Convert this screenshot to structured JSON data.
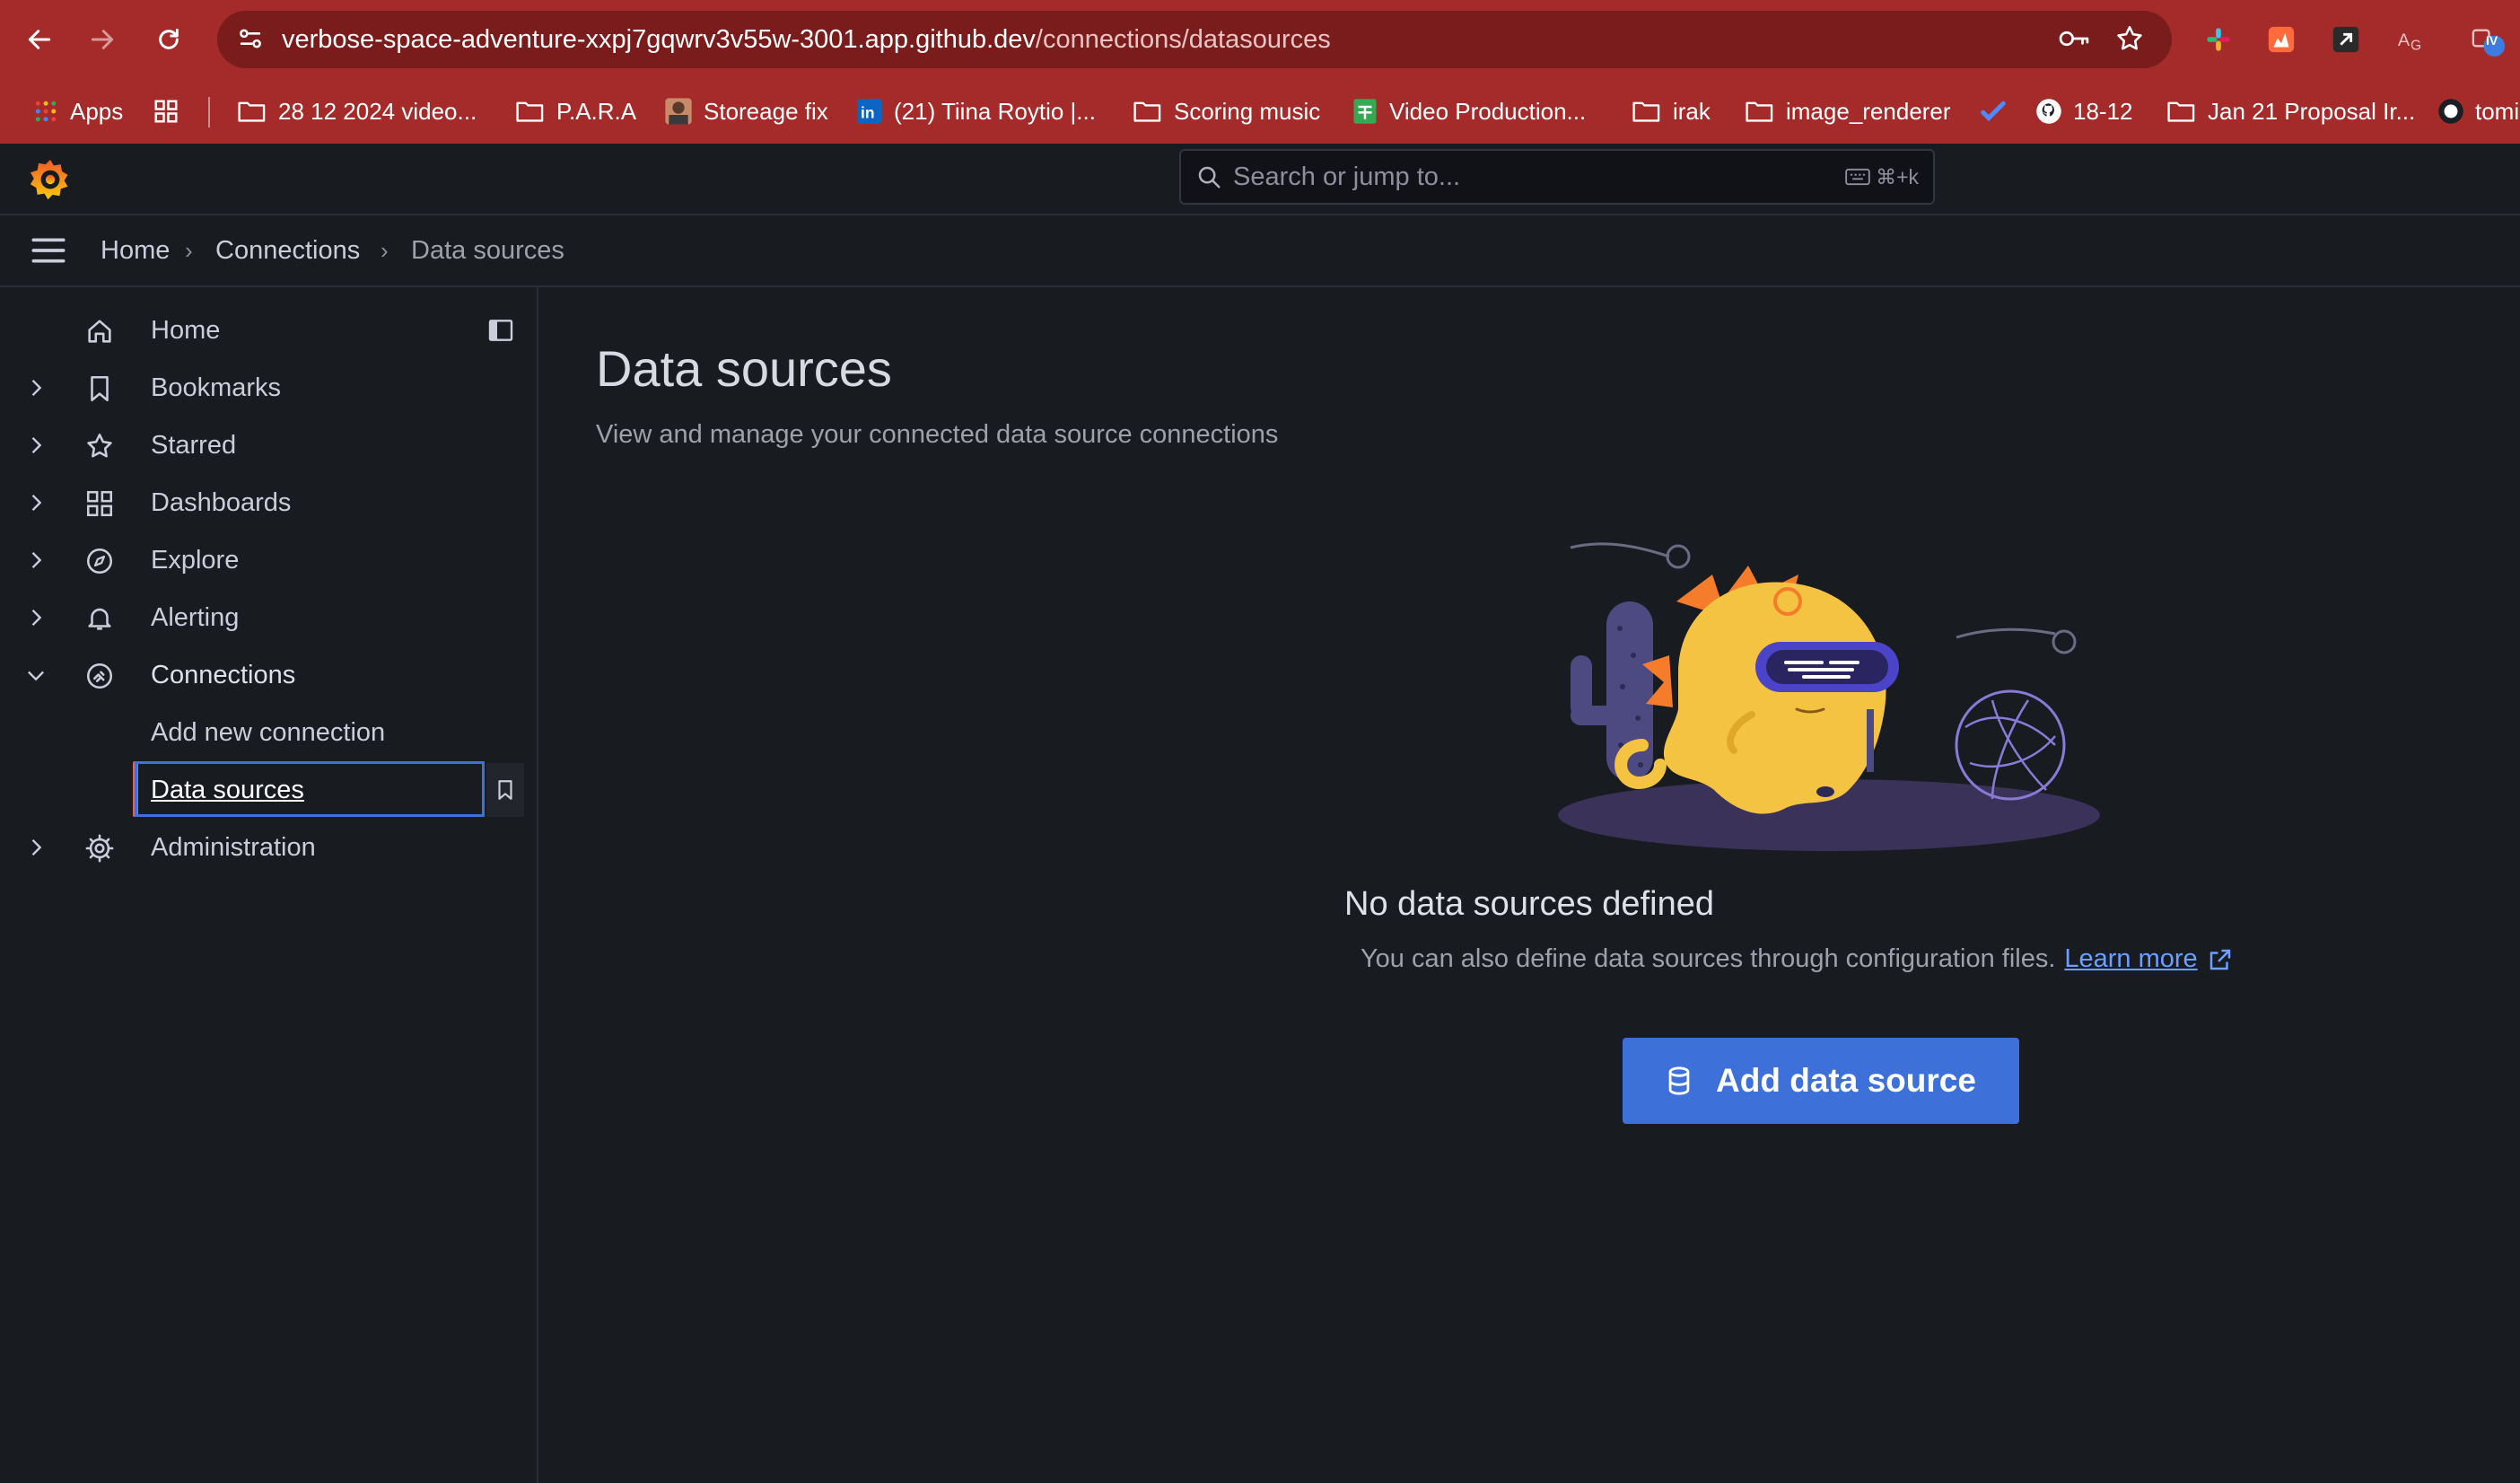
{
  "browser": {
    "url_host": "verbose-space-adventure-xxpj7gqwrv3v55w-3001.app.github.dev",
    "url_path": "/connections/datasources",
    "profile_badge": "IV",
    "bookmarks": [
      {
        "label": "Apps",
        "icon": "apps-grid-icon"
      },
      {
        "label": "",
        "icon": "grid-icon"
      },
      {
        "label": "28 12 2024 video...",
        "icon": "folder-icon"
      },
      {
        "label": "P.A.R.A",
        "icon": "folder-icon"
      },
      {
        "label": "Storeage fix",
        "icon": "avatar-icon"
      },
      {
        "label": "(21) Tiina Roytio |...",
        "icon": "linkedin-icon"
      },
      {
        "label": "Scoring music",
        "icon": "folder-icon"
      },
      {
        "label": "Video Production...",
        "icon": "sheets-icon"
      },
      {
        "label": "irak",
        "icon": "folder-icon"
      },
      {
        "label": "image_renderer",
        "icon": "folder-icon"
      },
      {
        "label": "",
        "icon": "check-icon"
      },
      {
        "label": "18-12",
        "icon": "github-icon"
      },
      {
        "label": "Jan 21 Proposal Ir...",
        "icon": "folder-icon"
      },
      {
        "label": "tomi",
        "icon": "github-icon"
      }
    ]
  },
  "topbar": {
    "search_placeholder": "Search or jump to...",
    "shortcut": "⌘+k"
  },
  "breadcrumb": {
    "items": [
      "Home",
      "Connections",
      "Data sources"
    ]
  },
  "sidebar": {
    "items": [
      {
        "label": "Home",
        "icon": "home-icon",
        "expandable": false
      },
      {
        "label": "Bookmarks",
        "icon": "bookmark-icon",
        "expandable": true
      },
      {
        "label": "Starred",
        "icon": "star-icon",
        "expandable": true
      },
      {
        "label": "Dashboards",
        "icon": "dashboards-icon",
        "expandable": true
      },
      {
        "label": "Explore",
        "icon": "compass-icon",
        "expandable": true
      },
      {
        "label": "Alerting",
        "icon": "bell-icon",
        "expandable": true
      },
      {
        "label": "Connections",
        "icon": "connections-icon",
        "expandable": true,
        "expanded": true
      },
      {
        "label": "Add new connection",
        "sub": true
      },
      {
        "label": "Data sources",
        "sub": true,
        "active": true
      },
      {
        "label": "Administration",
        "icon": "gear-icon",
        "expandable": true
      }
    ]
  },
  "main": {
    "title": "Data sources",
    "subtitle": "View and manage your connected data source connections",
    "empty_title": "No data sources defined",
    "empty_text": "You can also define data sources through configuration files.",
    "learn_more": "Learn more",
    "add_button": "Add data source"
  },
  "colors": {
    "browser_chrome": "#a52a2a",
    "background": "#181b1f",
    "primary": "#3d71d9",
    "accent": "#f55f3e"
  }
}
